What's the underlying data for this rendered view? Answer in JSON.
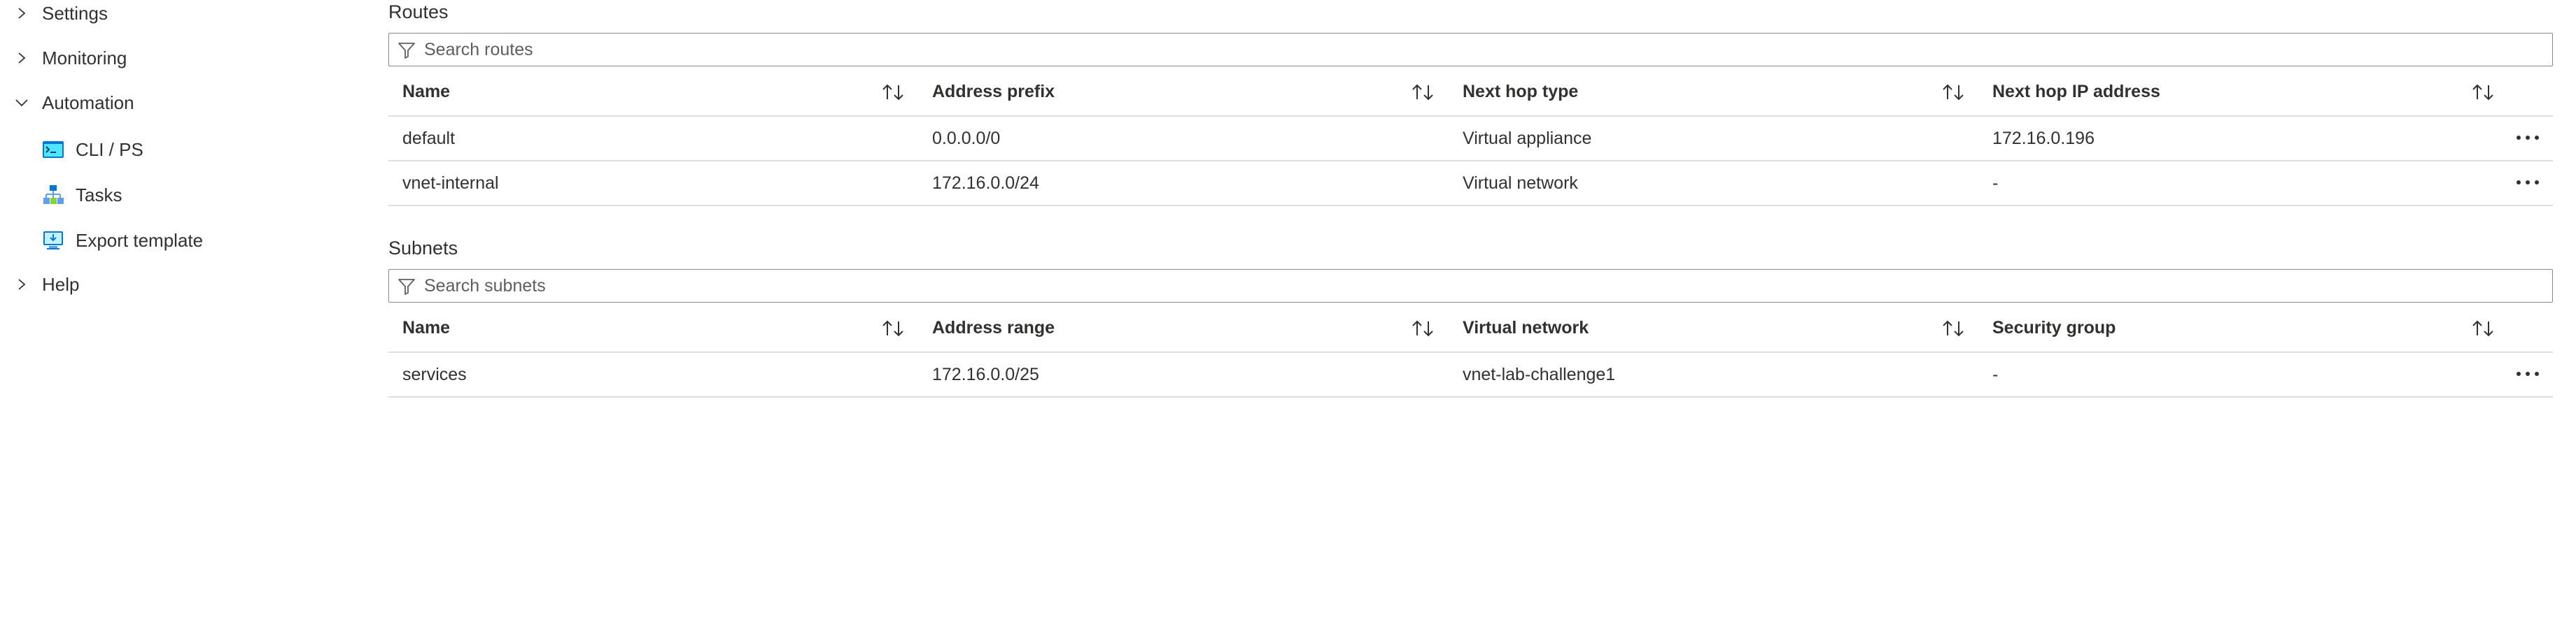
{
  "sidebar": {
    "settings": {
      "label": "Settings",
      "expanded": false
    },
    "monitoring": {
      "label": "Monitoring",
      "expanded": false
    },
    "automation": {
      "label": "Automation",
      "expanded": true,
      "items": [
        {
          "label": "CLI / PS",
          "icon": "cli-ps-icon"
        },
        {
          "label": "Tasks",
          "icon": "tasks-icon"
        },
        {
          "label": "Export template",
          "icon": "export-template-icon"
        }
      ]
    },
    "help": {
      "label": "Help",
      "expanded": false
    }
  },
  "routes": {
    "title": "Routes",
    "search_placeholder": "Search routes",
    "columns": [
      "Name",
      "Address prefix",
      "Next hop type",
      "Next hop IP address"
    ],
    "rows": [
      [
        "default",
        "0.0.0.0/0",
        "Virtual appliance",
        "172.16.0.196"
      ],
      [
        "vnet-internal",
        "172.16.0.0/24",
        "Virtual network",
        "-"
      ]
    ]
  },
  "subnets": {
    "title": "Subnets",
    "search_placeholder": "Search subnets",
    "columns": [
      "Name",
      "Address range",
      "Virtual network",
      "Security group"
    ],
    "rows": [
      [
        "services",
        "172.16.0.0/25",
        "vnet-lab-challenge1",
        "-"
      ]
    ]
  },
  "colors": {
    "text": "#323130",
    "border": "#e1dfdd",
    "input_border": "#8a8886",
    "icon_blue": "#0078d4"
  }
}
